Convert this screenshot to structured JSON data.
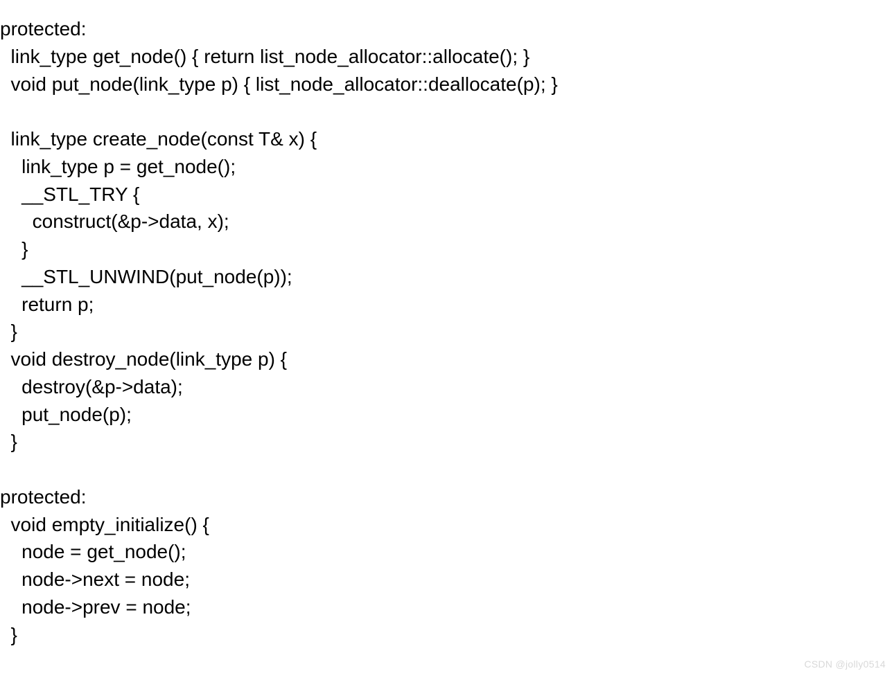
{
  "code": {
    "l01": "protected:",
    "l02": "  link_type get_node() { return list_node_allocator::allocate(); }",
    "l03": "  void put_node(link_type p) { list_node_allocator::deallocate(p); }",
    "l04": "",
    "l05": "  link_type create_node(const T& x) {",
    "l06": "    link_type p = get_node();",
    "l07": "    __STL_TRY {",
    "l08": "      construct(&p->data, x);",
    "l09": "    }",
    "l10": "    __STL_UNWIND(put_node(p));",
    "l11": "    return p;",
    "l12": "  }",
    "l13": "  void destroy_node(link_type p) {",
    "l14": "    destroy(&p->data);",
    "l15": "    put_node(p);",
    "l16": "  }",
    "l17": "",
    "l18": "protected:",
    "l19": "  void empty_initialize() {",
    "l20": "    node = get_node();",
    "l21": "    node->next = node;",
    "l22": "    node->prev = node;",
    "l23": "  }"
  },
  "watermark": "CSDN @jolly0514"
}
